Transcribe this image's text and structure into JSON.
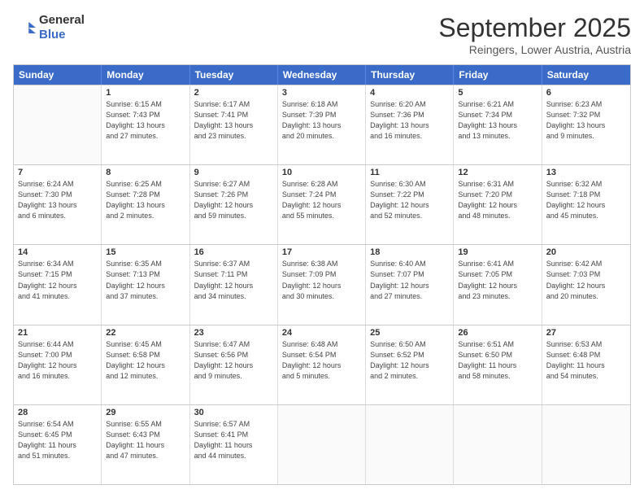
{
  "header": {
    "logo_line1": "General",
    "logo_line2": "Blue",
    "month": "September 2025",
    "location": "Reingers, Lower Austria, Austria"
  },
  "days": [
    "Sunday",
    "Monday",
    "Tuesday",
    "Wednesday",
    "Thursday",
    "Friday",
    "Saturday"
  ],
  "rows": [
    [
      {
        "day": "",
        "info": ""
      },
      {
        "day": "1",
        "info": "Sunrise: 6:15 AM\nSunset: 7:43 PM\nDaylight: 13 hours\nand 27 minutes."
      },
      {
        "day": "2",
        "info": "Sunrise: 6:17 AM\nSunset: 7:41 PM\nDaylight: 13 hours\nand 23 minutes."
      },
      {
        "day": "3",
        "info": "Sunrise: 6:18 AM\nSunset: 7:39 PM\nDaylight: 13 hours\nand 20 minutes."
      },
      {
        "day": "4",
        "info": "Sunrise: 6:20 AM\nSunset: 7:36 PM\nDaylight: 13 hours\nand 16 minutes."
      },
      {
        "day": "5",
        "info": "Sunrise: 6:21 AM\nSunset: 7:34 PM\nDaylight: 13 hours\nand 13 minutes."
      },
      {
        "day": "6",
        "info": "Sunrise: 6:23 AM\nSunset: 7:32 PM\nDaylight: 13 hours\nand 9 minutes."
      }
    ],
    [
      {
        "day": "7",
        "info": "Sunrise: 6:24 AM\nSunset: 7:30 PM\nDaylight: 13 hours\nand 6 minutes."
      },
      {
        "day": "8",
        "info": "Sunrise: 6:25 AM\nSunset: 7:28 PM\nDaylight: 13 hours\nand 2 minutes."
      },
      {
        "day": "9",
        "info": "Sunrise: 6:27 AM\nSunset: 7:26 PM\nDaylight: 12 hours\nand 59 minutes."
      },
      {
        "day": "10",
        "info": "Sunrise: 6:28 AM\nSunset: 7:24 PM\nDaylight: 12 hours\nand 55 minutes."
      },
      {
        "day": "11",
        "info": "Sunrise: 6:30 AM\nSunset: 7:22 PM\nDaylight: 12 hours\nand 52 minutes."
      },
      {
        "day": "12",
        "info": "Sunrise: 6:31 AM\nSunset: 7:20 PM\nDaylight: 12 hours\nand 48 minutes."
      },
      {
        "day": "13",
        "info": "Sunrise: 6:32 AM\nSunset: 7:18 PM\nDaylight: 12 hours\nand 45 minutes."
      }
    ],
    [
      {
        "day": "14",
        "info": "Sunrise: 6:34 AM\nSunset: 7:15 PM\nDaylight: 12 hours\nand 41 minutes."
      },
      {
        "day": "15",
        "info": "Sunrise: 6:35 AM\nSunset: 7:13 PM\nDaylight: 12 hours\nand 37 minutes."
      },
      {
        "day": "16",
        "info": "Sunrise: 6:37 AM\nSunset: 7:11 PM\nDaylight: 12 hours\nand 34 minutes."
      },
      {
        "day": "17",
        "info": "Sunrise: 6:38 AM\nSunset: 7:09 PM\nDaylight: 12 hours\nand 30 minutes."
      },
      {
        "day": "18",
        "info": "Sunrise: 6:40 AM\nSunset: 7:07 PM\nDaylight: 12 hours\nand 27 minutes."
      },
      {
        "day": "19",
        "info": "Sunrise: 6:41 AM\nSunset: 7:05 PM\nDaylight: 12 hours\nand 23 minutes."
      },
      {
        "day": "20",
        "info": "Sunrise: 6:42 AM\nSunset: 7:03 PM\nDaylight: 12 hours\nand 20 minutes."
      }
    ],
    [
      {
        "day": "21",
        "info": "Sunrise: 6:44 AM\nSunset: 7:00 PM\nDaylight: 12 hours\nand 16 minutes."
      },
      {
        "day": "22",
        "info": "Sunrise: 6:45 AM\nSunset: 6:58 PM\nDaylight: 12 hours\nand 12 minutes."
      },
      {
        "day": "23",
        "info": "Sunrise: 6:47 AM\nSunset: 6:56 PM\nDaylight: 12 hours\nand 9 minutes."
      },
      {
        "day": "24",
        "info": "Sunrise: 6:48 AM\nSunset: 6:54 PM\nDaylight: 12 hours\nand 5 minutes."
      },
      {
        "day": "25",
        "info": "Sunrise: 6:50 AM\nSunset: 6:52 PM\nDaylight: 12 hours\nand 2 minutes."
      },
      {
        "day": "26",
        "info": "Sunrise: 6:51 AM\nSunset: 6:50 PM\nDaylight: 11 hours\nand 58 minutes."
      },
      {
        "day": "27",
        "info": "Sunrise: 6:53 AM\nSunset: 6:48 PM\nDaylight: 11 hours\nand 54 minutes."
      }
    ],
    [
      {
        "day": "28",
        "info": "Sunrise: 6:54 AM\nSunset: 6:45 PM\nDaylight: 11 hours\nand 51 minutes."
      },
      {
        "day": "29",
        "info": "Sunrise: 6:55 AM\nSunset: 6:43 PM\nDaylight: 11 hours\nand 47 minutes."
      },
      {
        "day": "30",
        "info": "Sunrise: 6:57 AM\nSunset: 6:41 PM\nDaylight: 11 hours\nand 44 minutes."
      },
      {
        "day": "",
        "info": ""
      },
      {
        "day": "",
        "info": ""
      },
      {
        "day": "",
        "info": ""
      },
      {
        "day": "",
        "info": ""
      }
    ]
  ]
}
